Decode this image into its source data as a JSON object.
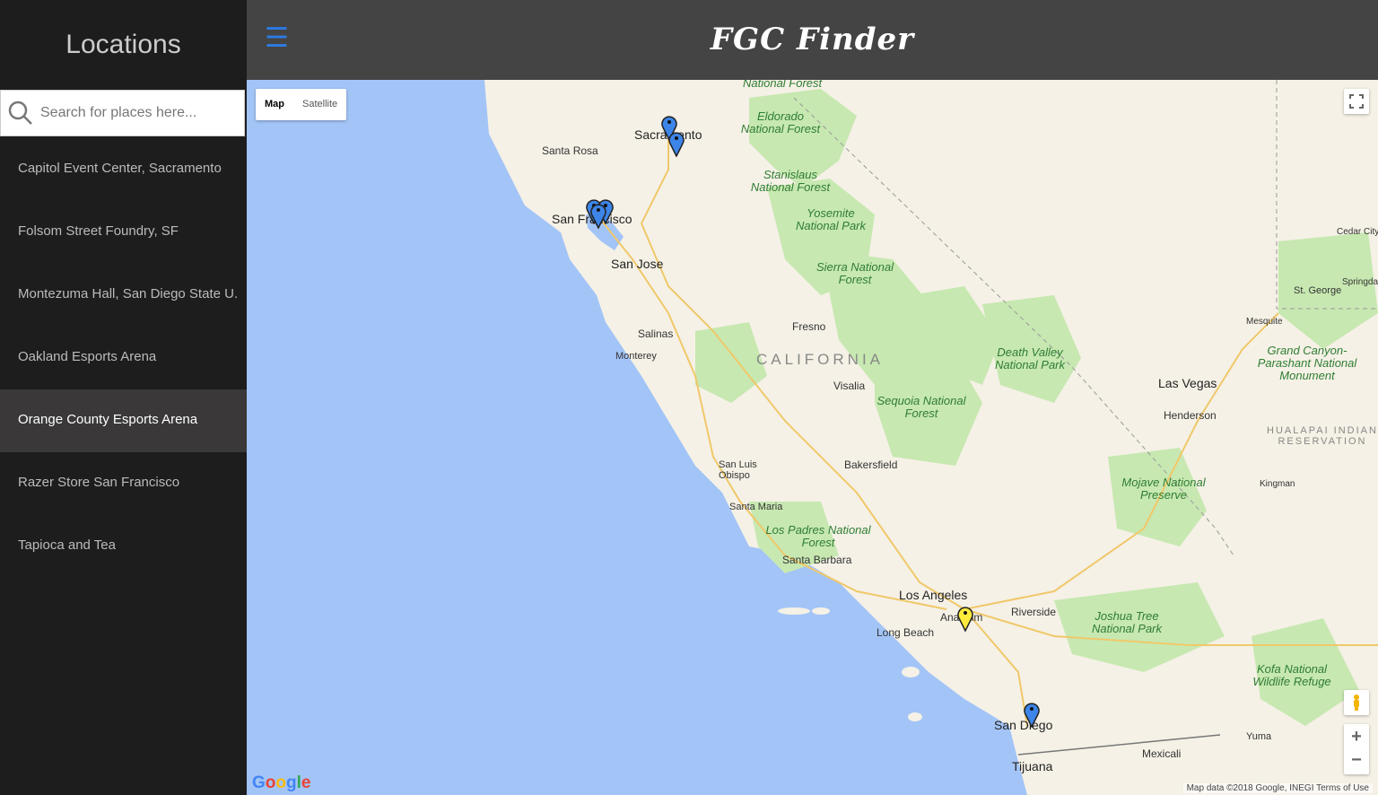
{
  "sidebar": {
    "title": "Locations",
    "search_placeholder": "Search for places here...",
    "items": [
      {
        "label": "Capitol Event Center, Sacramento",
        "selected": false
      },
      {
        "label": "Folsom Street Foundry, SF",
        "selected": false
      },
      {
        "label": "Montezuma Hall, San Diego State U.",
        "selected": false
      },
      {
        "label": "Oakland Esports Arena",
        "selected": false
      },
      {
        "label": "Orange County Esports Arena",
        "selected": true
      },
      {
        "label": "Razer Store San Francisco",
        "selected": false
      },
      {
        "label": "Tapioca and Tea",
        "selected": false
      }
    ]
  },
  "header": {
    "menu_icon": "hamburger-icon",
    "title": "FGC Finder"
  },
  "map": {
    "map_type": {
      "map": "Map",
      "satellite": "Satellite",
      "active": "Map"
    },
    "labels": {
      "sacramento": "Sacramento",
      "santa_rosa": "Santa Rosa",
      "san_francisco": "San Francisco",
      "san_jose": "San Jose",
      "salinas": "Salinas",
      "monterey": "Monterey",
      "fresno": "Fresno",
      "visalia": "Visalia",
      "california": "CALIFORNIA",
      "bakersfield": "Bakersfield",
      "san_luis_obispo": "San Luis Obispo",
      "santa_maria": "Santa Maria",
      "santa_barbara": "Santa Barbara",
      "los_angeles": "Los Angeles",
      "anaheim": "Anaheim",
      "long_beach": "Long Beach",
      "riverside": "Riverside",
      "san_diego": "San Diego",
      "tijuana": "Tijuana",
      "mexicali": "Mexicali",
      "yuma": "Yuma",
      "las_vegas": "Las Vegas",
      "henderson": "Henderson",
      "kingman": "Kingman",
      "mesquite": "Mesquite",
      "st_george": "St. George",
      "cedar_city": "Cedar City",
      "springdale": "Springdale",
      "hualapai": "HUALAPAI INDIAN RESERVATION",
      "eldorado": "Eldorado National Forest",
      "stanislaus": "Stanislaus National Forest",
      "yosemite": "Yosemite National Park",
      "sierra": "Sierra National Forest",
      "sequoia": "Sequoia National Forest",
      "death_valley": "Death Valley National Park",
      "mojave": "Mojave National Preserve",
      "grand_canyon": "Grand Canyon-Parashant National Monument",
      "los_padres": "Los Padres National Forest",
      "joshua_tree": "Joshua Tree National Park",
      "kofa": "Kofa National Wildlife Refuge",
      "national_forest_top": "National Forest"
    },
    "pins": [
      {
        "name": "pin-capitol-event-center",
        "color": "#3d85e8"
      },
      {
        "name": "pin-sacramento-2",
        "color": "#3d85e8"
      },
      {
        "name": "pin-folsom-street-foundry",
        "color": "#3d85e8"
      },
      {
        "name": "pin-razer-store-sf",
        "color": "#3d85e8"
      },
      {
        "name": "pin-oakland-esports",
        "color": "#3d85e8"
      },
      {
        "name": "pin-orange-county-esports",
        "color": "#ffeb3b"
      },
      {
        "name": "pin-montezuma-hall",
        "color": "#3d85e8"
      }
    ],
    "google_logo": "Google",
    "footer": "Map data ©2018 Google, INEGI   Terms of Use"
  },
  "colors": {
    "sidebar_bg": "#1d1d1d",
    "header_bg": "#444444",
    "accent": "#2c7be5",
    "water": "#a3c4f7",
    "land": "#f5f1e6",
    "park": "#c7e8b1"
  }
}
